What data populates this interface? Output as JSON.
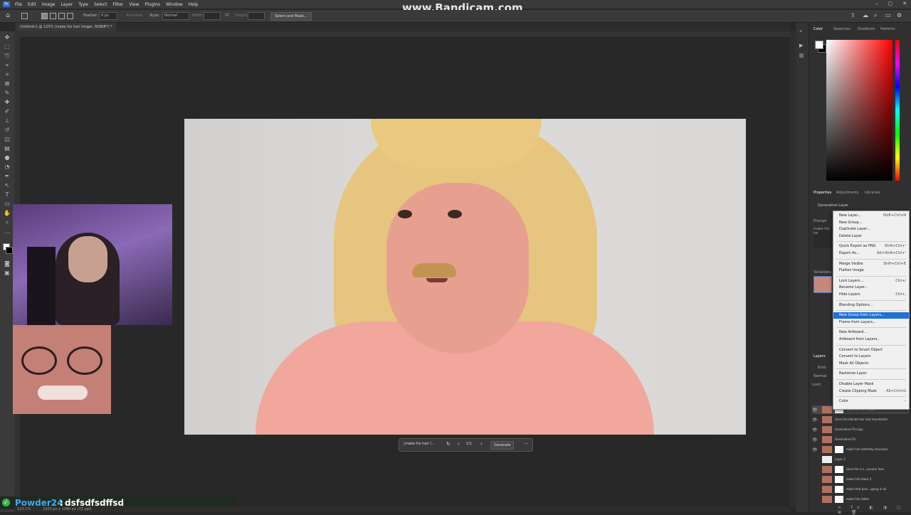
{
  "watermark": "www.Bandicam.com",
  "menu": [
    "File",
    "Edit",
    "Image",
    "Layer",
    "Type",
    "Select",
    "Filter",
    "View",
    "Plugins",
    "Window",
    "Help"
  ],
  "app_logo": "Ps",
  "options": {
    "feather_label": "Feather:",
    "feather_value": "0 px",
    "antialias": "Anti-alias",
    "style_label": "Style:",
    "style_value": "Normal",
    "width_label": "Width:",
    "height_label": "Height:",
    "select_mask": "Select and Mask..."
  },
  "document_tab": "Untitled-1 @ 123% (make his hair longer, RGB/8*) *",
  "generative_bar": {
    "prompt": "make his hair l...",
    "counter": "1/1",
    "generate": "Generate"
  },
  "stream": {
    "user": "Powder24",
    "separator": ":",
    "message": "dsfsdfsdffsd"
  },
  "status_zoom": "123.1%",
  "status_size": "1920 px x 1080 px (72 ppi)",
  "panels": {
    "color_tabs": [
      "Color",
      "Swatches",
      "Gradients",
      "Patterns"
    ],
    "props_tabs": [
      "Properties",
      "Adjustments",
      "Libraries"
    ],
    "props_title": "Generative Layer",
    "prompt_label": "Prompt",
    "prompt_value": "make his ha",
    "variations_label": "Variations",
    "layers_title": "Layers",
    "kind_label": "Kind",
    "blend_mode": "Normal",
    "lock_label": "Lock:"
  },
  "layers": [
    {
      "name": "make his hair longer"
    },
    {
      "name": "Give him blonde hair and moustache"
    },
    {
      "name": "Generative Fill copy"
    },
    {
      "name": "Generative Fill"
    },
    {
      "name": "make him extremly muscular"
    },
    {
      "name": "Layer 2"
    },
    {
      "name": "Give him a c...uscular face"
    },
    {
      "name": "make him black 2"
    },
    {
      "name": "make that pers...pping in oil"
    },
    {
      "name": "make him fatter"
    }
  ],
  "context_menu": [
    {
      "label": "New Layer...",
      "shortcut": "Shift+Ctrl+N"
    },
    {
      "label": "New Group...",
      "shortcut": ""
    },
    {
      "label": "Duplicate Layer...",
      "shortcut": ""
    },
    {
      "label": "Delete Layer",
      "shortcut": ""
    },
    {
      "sep": true
    },
    {
      "label": "Quick Export as PNG",
      "shortcut": "Shift+Ctrl+'"
    },
    {
      "label": "Export As...",
      "shortcut": "Alt+Shift+Ctrl+'"
    },
    {
      "sep": true
    },
    {
      "label": "Merge Visible",
      "shortcut": "Shift+Ctrl+E"
    },
    {
      "label": "Flatten Image",
      "shortcut": ""
    },
    {
      "sep": true
    },
    {
      "label": "Lock Layers...",
      "shortcut": "Ctrl+/"
    },
    {
      "label": "Rename Layer...",
      "shortcut": ""
    },
    {
      "label": "Hide Layers",
      "shortcut": "Ctrl+,"
    },
    {
      "sep": true
    },
    {
      "label": "Blending Options...",
      "shortcut": ""
    },
    {
      "sep": true
    },
    {
      "label": "New Group from Layers...",
      "shortcut": "",
      "highlighted": true
    },
    {
      "label": "Frame from Layers...",
      "shortcut": ""
    },
    {
      "sep": true
    },
    {
      "label": "New Artboard...",
      "shortcut": ""
    },
    {
      "label": "Artboard from Layers...",
      "shortcut": ""
    },
    {
      "sep": true
    },
    {
      "label": "Convert to Smart Object",
      "shortcut": ""
    },
    {
      "label": "Convert to Layers",
      "shortcut": ""
    },
    {
      "label": "Mask All Objects",
      "shortcut": ""
    },
    {
      "sep": true
    },
    {
      "label": "Rasterize Layer",
      "shortcut": ""
    },
    {
      "sep": true
    },
    {
      "label": "Disable Layer Mask",
      "shortcut": ""
    },
    {
      "label": "Create Clipping Mask",
      "shortcut": "Alt+Ctrl+G"
    },
    {
      "sep": true
    },
    {
      "label": "Color",
      "shortcut": "›"
    }
  ]
}
